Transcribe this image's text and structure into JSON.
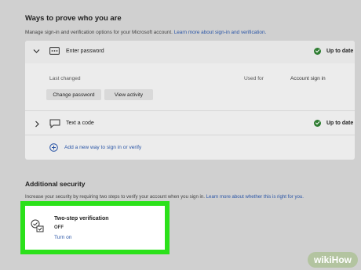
{
  "ways": {
    "title": "Ways to prove who you are",
    "description": "Manage sign-in and verification options for your Microsoft account.",
    "learn_more": "Learn more about sign-in and verification."
  },
  "password": {
    "label": "Enter password",
    "status": "Up to date",
    "last_changed_label": "Last changed",
    "used_for_label": "Used for",
    "used_for_value": "Account sign in",
    "change_password": "Change password",
    "view_activity": "View activity"
  },
  "text_code": {
    "label": "Text a code",
    "status": "Up to date"
  },
  "add_way": "Add a new way to sign in or verify",
  "additional": {
    "title": "Additional security",
    "description": "Increase your security by requiring two steps to verify your account when you sign in.",
    "learn_more": "Learn more about whether this is right for you."
  },
  "two_step": {
    "title": "Two-step verification",
    "state": "OFF",
    "action": "Turn on"
  },
  "watermark": "wikiHow",
  "colors": {
    "highlight": "#2be11a",
    "status_check": "#2f7d32",
    "link": "#2a55a6"
  }
}
